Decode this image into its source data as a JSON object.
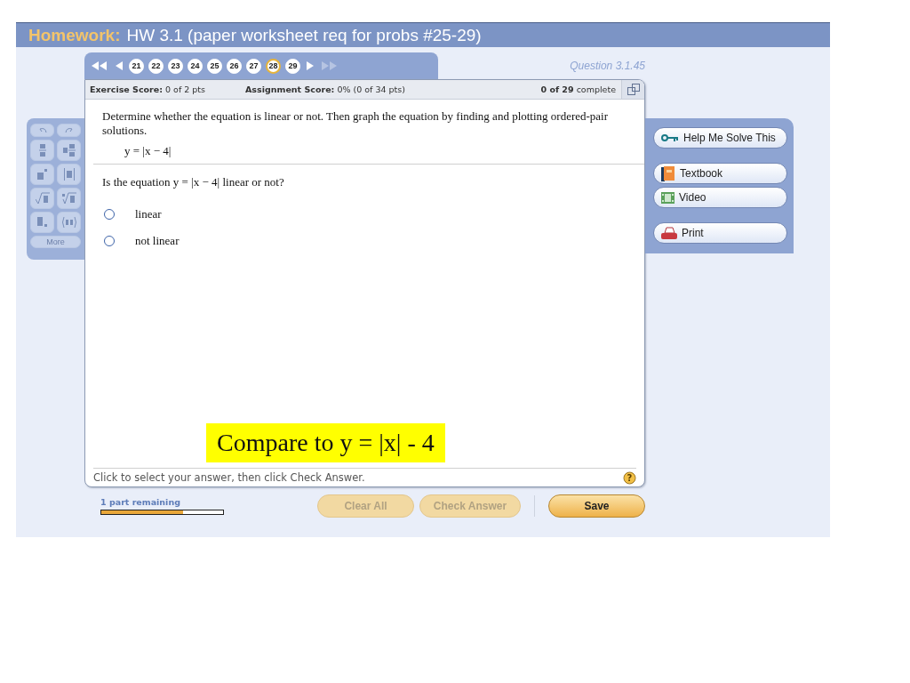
{
  "header": {
    "label": "Homework:",
    "title": "HW 3.1 (paper worksheet req for probs #25-29)"
  },
  "question_nav": [
    {
      "kind": "first",
      "disabled": false
    },
    {
      "kind": "prev",
      "disabled": false
    },
    {
      "kind": "number",
      "label": "21",
      "selected": false
    },
    {
      "kind": "number",
      "label": "22",
      "selected": false
    },
    {
      "kind": "number",
      "label": "23",
      "selected": false
    },
    {
      "kind": "number",
      "label": "24",
      "selected": false
    },
    {
      "kind": "number",
      "label": "25",
      "selected": false
    },
    {
      "kind": "number",
      "label": "26",
      "selected": false
    },
    {
      "kind": "number",
      "label": "27",
      "selected": false
    },
    {
      "kind": "number",
      "label": "28",
      "selected": true
    },
    {
      "kind": "number",
      "label": "29",
      "selected": false
    },
    {
      "kind": "next",
      "disabled": false
    },
    {
      "kind": "last",
      "disabled": true
    }
  ],
  "question_id": "Question 3.1.45",
  "scores": {
    "exercise_label": "Exercise Score:",
    "exercise_value": "0 of 2 pts",
    "assignment_label": "Assignment Score:",
    "assignment_value": "0% (0 of 34 pts)",
    "complete_count": "0 of 29",
    "complete_label": "complete"
  },
  "math_palette": {
    "buttons": [
      {
        "kind": "undo",
        "disabled": true
      },
      {
        "kind": "redo",
        "disabled": true
      },
      {
        "kind": "fraction",
        "disabled": true
      },
      {
        "kind": "mixed",
        "disabled": true
      },
      {
        "kind": "exponent",
        "disabled": true
      },
      {
        "kind": "abs",
        "disabled": true
      },
      {
        "kind": "sqrt",
        "disabled": true
      },
      {
        "kind": "nroot",
        "disabled": true
      },
      {
        "kind": "decimal",
        "disabled": true
      },
      {
        "kind": "pair",
        "disabled": true
      }
    ],
    "more": {
      "label": "More",
      "disabled": true
    }
  },
  "question": {
    "instructions": "Determine whether the equation is linear or not. Then graph the equation by finding and plotting ordered-pair solutions.",
    "equation": "y = |x − 4|",
    "prompt": "Is the equation y = |x − 4| linear or not?",
    "options": [
      {
        "label": "linear",
        "selected": false
      },
      {
        "label": "not linear",
        "selected": false
      }
    ],
    "annotation": "Compare to y = |x| - 4"
  },
  "footer_hint": "Click to select your answer, then click Check Answer.",
  "help_mark": "?",
  "tools": [
    {
      "kind": "key",
      "label": "Help Me Solve This"
    },
    {
      "kind": "book",
      "label": "Textbook"
    },
    {
      "kind": "film",
      "label": "Video"
    },
    {
      "kind": "printer",
      "label": "Print"
    }
  ],
  "progress": {
    "label": "1 part remaining",
    "level": 0.67
  },
  "actions": [
    {
      "kind": "secondary",
      "label": "Clear All",
      "disabled": true
    },
    {
      "kind": "secondary",
      "label": "Check Answer",
      "disabled": true
    },
    {
      "kind": "primary",
      "label": "Save",
      "disabled": false
    }
  ]
}
